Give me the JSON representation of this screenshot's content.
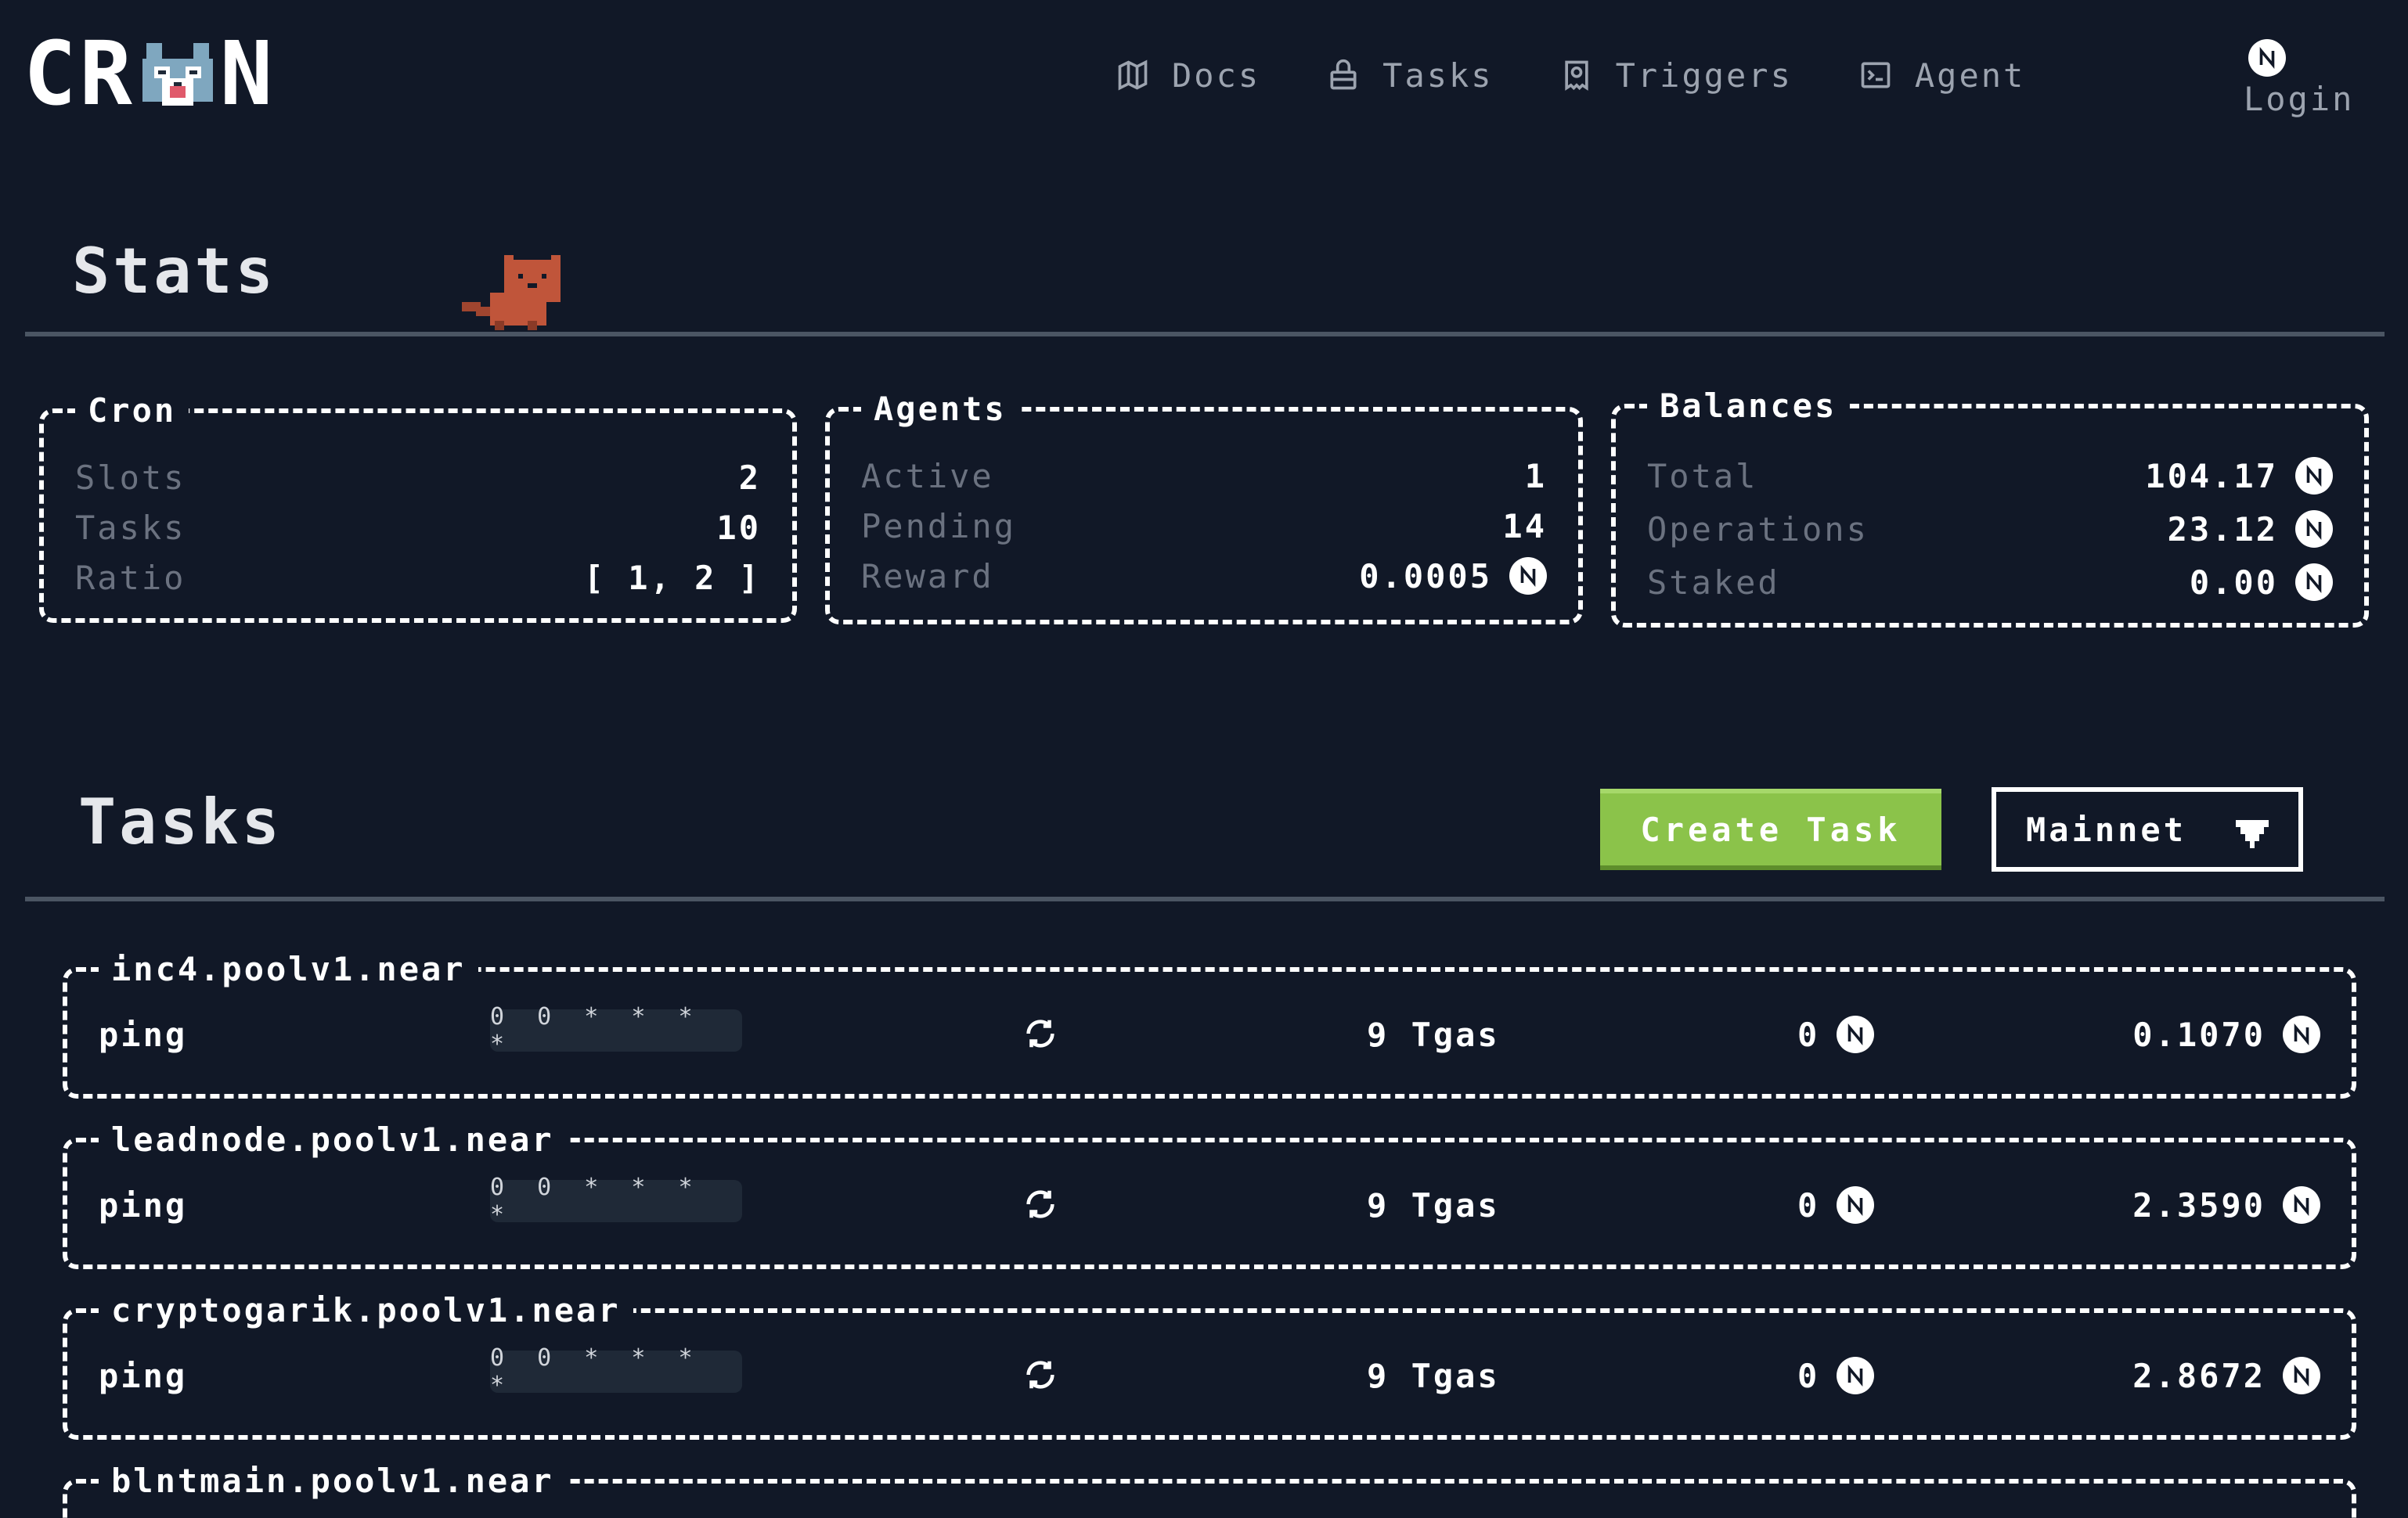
{
  "header": {
    "logo_left": "CR",
    "logo_right": "N",
    "nav": [
      {
        "label": "Docs",
        "icon": "map-icon"
      },
      {
        "label": "Tasks",
        "icon": "basket-icon"
      },
      {
        "label": "Triggers",
        "icon": "receipt-icon"
      },
      {
        "label": "Agent",
        "icon": "terminal-icon"
      }
    ],
    "login_label": "Login"
  },
  "stats": {
    "title": "Stats",
    "cron": {
      "legend": "Cron",
      "rows": [
        {
          "label": "Slots",
          "value": "2"
        },
        {
          "label": "Tasks",
          "value": "10"
        },
        {
          "label": "Ratio",
          "value": "[ 1, 2 ]"
        }
      ]
    },
    "agents": {
      "legend": "Agents",
      "rows": [
        {
          "label": "Active",
          "value": "1"
        },
        {
          "label": "Pending",
          "value": "14"
        },
        {
          "label": "Reward",
          "value": "0.0005"
        }
      ]
    },
    "balances": {
      "legend": "Balances",
      "rows": [
        {
          "label": "Total",
          "value": "104.17"
        },
        {
          "label": "Operations",
          "value": "23.12"
        },
        {
          "label": "Staked",
          "value": "0.00"
        }
      ]
    }
  },
  "tasks": {
    "title": "Tasks",
    "create_label": "Create Task",
    "network_label": "Mainnet",
    "items": [
      {
        "contract": "inc4.poolv1.near",
        "function": "ping",
        "cadence": "0 0 * * * *",
        "gas": "9 Tgas",
        "deposit": "0",
        "balance": "0.1070"
      },
      {
        "contract": "leadnode.poolv1.near",
        "function": "ping",
        "cadence": "0 0 * * * *",
        "gas": "9 Tgas",
        "deposit": "0",
        "balance": "2.3590"
      },
      {
        "contract": "cryptogarik.poolv1.near",
        "function": "ping",
        "cadence": "0 0 * * * *",
        "gas": "9 Tgas",
        "deposit": "0",
        "balance": "2.8672"
      },
      {
        "contract": "blntmain.poolv1.near"
      }
    ]
  },
  "colors": {
    "background": "#111827",
    "accent_green": "#8bc34a",
    "muted_text": "#6b7280",
    "nav_text": "#9ca3af",
    "cat_orange": "#c0553a"
  }
}
